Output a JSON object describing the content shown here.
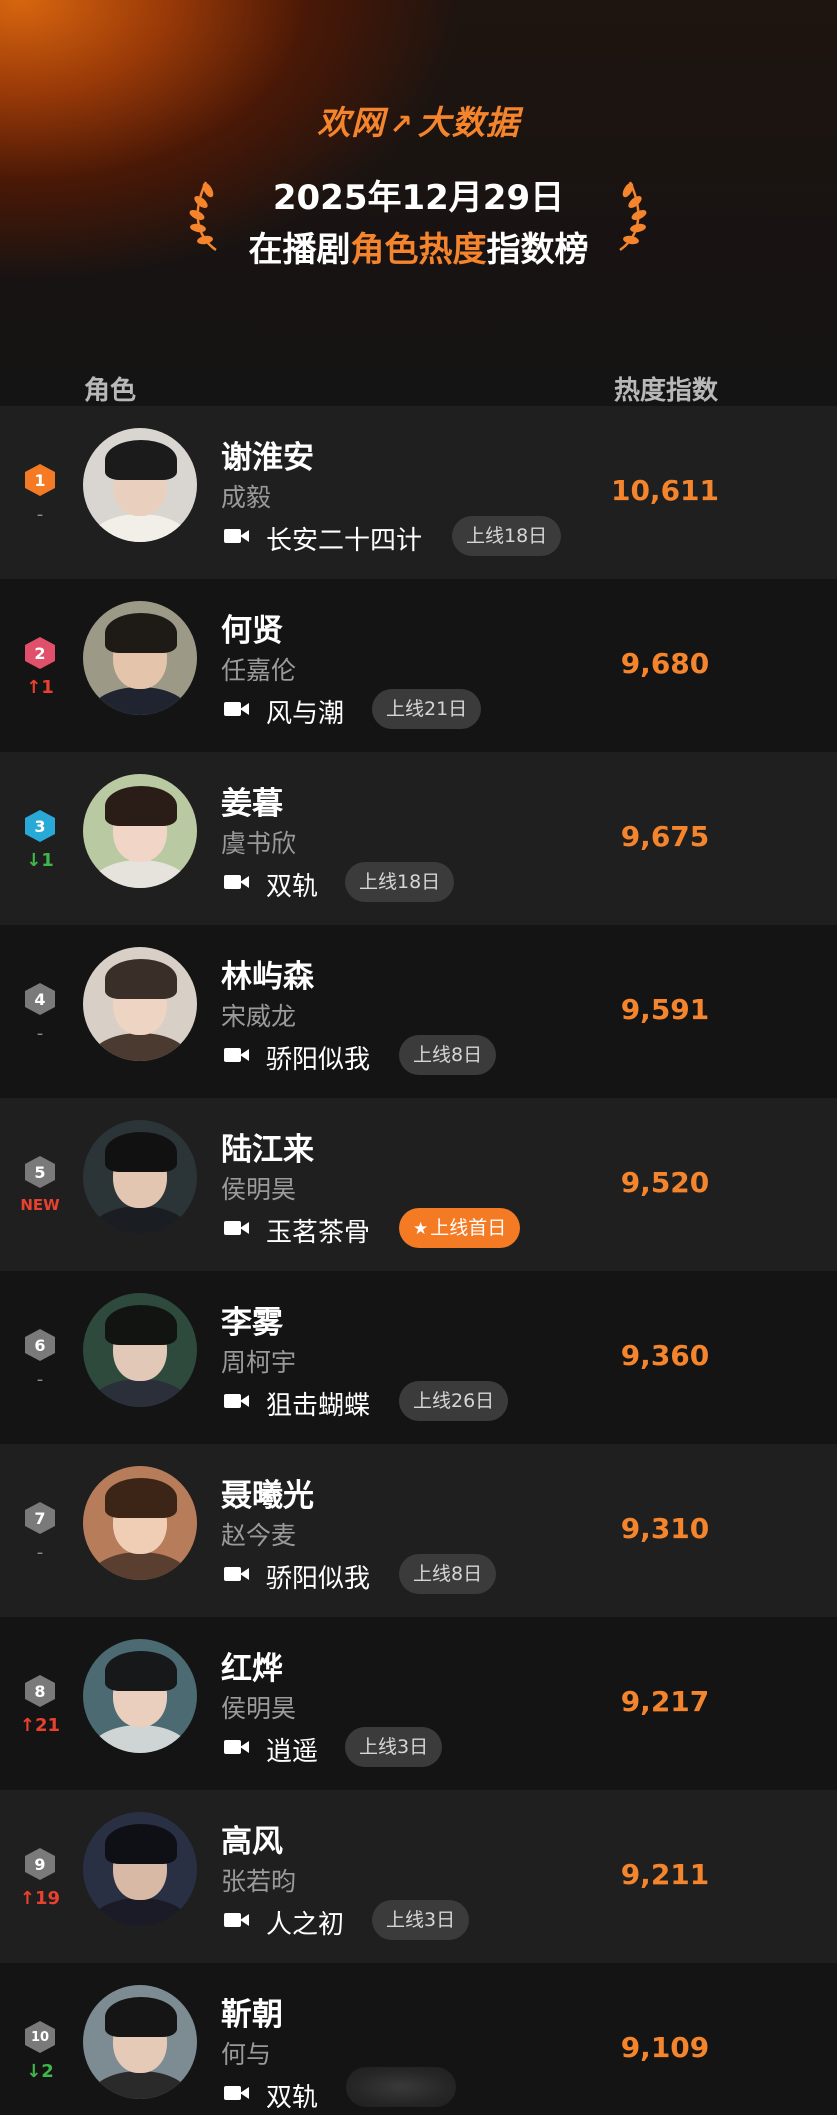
{
  "header": {
    "brand_left": "欢网",
    "brand_arrow": "↗",
    "brand_right": "大数据",
    "date": "2025年12月29日",
    "title_prefix": "在播剧",
    "title_highlight": "角色热度",
    "title_suffix": "指数榜"
  },
  "columns": {
    "role": "角色",
    "score": "热度指数"
  },
  "colors": {
    "accent": "#f4852c",
    "up": "#e8412f",
    "down": "#3fb74a",
    "rank1": "#f47a24",
    "rank2": "#e0506a",
    "rank3": "#29a9d6",
    "rank_other": "#7a7a7a"
  },
  "rows": [
    {
      "rank": "1",
      "change": "-",
      "change_type": "same",
      "name": "谢淮安",
      "actor": "成毅",
      "drama": "长安二十四计",
      "days": "上线18日",
      "hot": false,
      "score": "10,611"
    },
    {
      "rank": "2",
      "change": "↑1",
      "change_type": "up",
      "name": "何贤",
      "actor": "任嘉伦",
      "drama": "风与潮",
      "days": "上线21日",
      "hot": false,
      "score": "9,680"
    },
    {
      "rank": "3",
      "change": "↓1",
      "change_type": "down",
      "name": "姜暮",
      "actor": "虞书欣",
      "drama": "双轨",
      "days": "上线18日",
      "hot": false,
      "score": "9,675"
    },
    {
      "rank": "4",
      "change": "-",
      "change_type": "same",
      "name": "林屿森",
      "actor": "宋威龙",
      "drama": "骄阳似我",
      "days": "上线8日",
      "hot": false,
      "score": "9,591"
    },
    {
      "rank": "5",
      "change": "NEW",
      "change_type": "new",
      "name": "陆江来",
      "actor": "侯明昊",
      "drama": "玉茗茶骨",
      "days": "上线首日",
      "hot": true,
      "score": "9,520"
    },
    {
      "rank": "6",
      "change": "-",
      "change_type": "same",
      "name": "李雾",
      "actor": "周柯宇",
      "drama": "狙击蝴蝶",
      "days": "上线26日",
      "hot": false,
      "score": "9,360"
    },
    {
      "rank": "7",
      "change": "-",
      "change_type": "same",
      "name": "聂曦光",
      "actor": "赵今麦",
      "drama": "骄阳似我",
      "days": "上线8日",
      "hot": false,
      "score": "9,310"
    },
    {
      "rank": "8",
      "change": "↑21",
      "change_type": "up",
      "name": "红烨",
      "actor": "侯明昊",
      "drama": "逍遥",
      "days": "上线3日",
      "hot": false,
      "score": "9,217"
    },
    {
      "rank": "9",
      "change": "↑19",
      "change_type": "up",
      "name": "高风",
      "actor": "张若昀",
      "drama": "人之初",
      "days": "上线3日",
      "hot": false,
      "score": "9,211"
    },
    {
      "rank": "10",
      "change": "↓2",
      "change_type": "down",
      "name": "靳朝",
      "actor": "何与",
      "drama": "双轨",
      "days": "",
      "hot": false,
      "score": "9,109"
    }
  ]
}
